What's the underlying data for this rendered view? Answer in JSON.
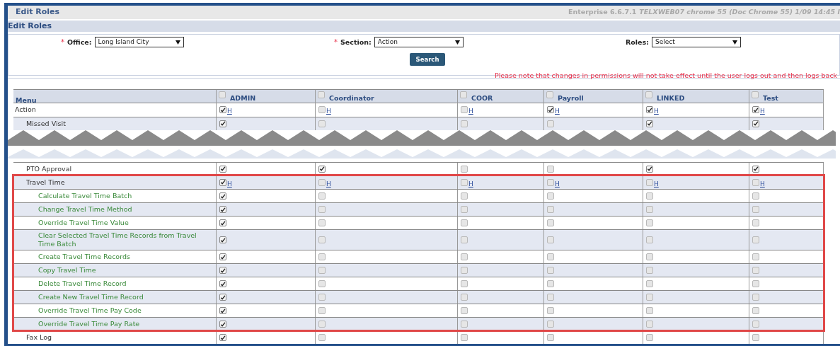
{
  "header": {
    "title": "Edit Roles",
    "version": "Enterprise 6.6.7.1",
    "build_info": "TELXWEB07 chrome 55 (Doc Chrome 55) 1/09 14:45 I"
  },
  "section_title": "Edit Roles",
  "filters": [
    {
      "required_mark": "*",
      "label": "Office:",
      "value": "Long Island City"
    },
    {
      "required_mark": "*",
      "label": "Section:",
      "value": "Action"
    },
    {
      "label": "Roles:",
      "value": "Select"
    }
  ],
  "search_button": "Search",
  "notice": "Please note that changes in permissions will not take effect until the user logs out and then logs back",
  "table": {
    "menu_heading": "Menu",
    "columns": [
      {
        "label": "ADMIN",
        "checked": false
      },
      {
        "label": "Coordinator",
        "checked": false
      },
      {
        "label": "COOR",
        "checked": false
      },
      {
        "label": "Payroll",
        "checked": false
      },
      {
        "label": "LINKED",
        "checked": false
      },
      {
        "label": "Test",
        "checked": false
      }
    ],
    "rows": [
      {
        "kind": "item",
        "name": "Action",
        "highlighted": false,
        "roles": [
          {
            "checked": true,
            "link": "H"
          },
          {
            "checked": false,
            "link": "H"
          },
          {
            "checked": false,
            "link": "H"
          },
          {
            "checked": true,
            "link": "H"
          },
          {
            "checked": true,
            "link": "H"
          },
          {
            "checked": true,
            "link": "H"
          }
        ],
        "children": [
          {
            "kind": "item",
            "name": "Missed Visit",
            "highlighted": false,
            "roles": [
              {
                "checked": true
              },
              {
                "checked": false
              },
              {
                "checked": false
              },
              {
                "checked": false
              },
              {
                "checked": true
              },
              {
                "checked": true
              }
            ]
          },
          {
            "kind": "break"
          },
          {
            "kind": "item",
            "name": "PTO Approval",
            "highlighted": false,
            "roles": [
              {
                "checked": true
              },
              {
                "checked": true
              },
              {
                "checked": false
              },
              {
                "checked": false
              },
              {
                "checked": true
              },
              {
                "checked": true
              }
            ]
          },
          {
            "kind": "item",
            "name": "Travel Time",
            "highlighted": true,
            "roles": [
              {
                "checked": true,
                "link": "H"
              },
              {
                "checked": false,
                "link": "H"
              },
              {
                "checked": false,
                "link": "H"
              },
              {
                "checked": false,
                "link": "H"
              },
              {
                "checked": false,
                "link": "H"
              },
              {
                "checked": false,
                "link": "H"
              }
            ],
            "children": [
              {
                "kind": "item",
                "name": "Calculate Travel Time Batch",
                "highlighted": false,
                "roles": [
                  {
                    "checked": true
                  },
                  {
                    "checked": false
                  },
                  {
                    "checked": false
                  },
                  {
                    "checked": false
                  },
                  {
                    "checked": false
                  },
                  {
                    "checked": false
                  }
                ]
              },
              {
                "kind": "item",
                "name": "Change Travel Time Method",
                "highlighted": false,
                "roles": [
                  {
                    "checked": true
                  },
                  {
                    "checked": false
                  },
                  {
                    "checked": false
                  },
                  {
                    "checked": false
                  },
                  {
                    "checked": false
                  },
                  {
                    "checked": false
                  }
                ]
              },
              {
                "kind": "item",
                "name": "Override Travel Time Value",
                "highlighted": false,
                "roles": [
                  {
                    "checked": true
                  },
                  {
                    "checked": false
                  },
                  {
                    "checked": false
                  },
                  {
                    "checked": false
                  },
                  {
                    "checked": false
                  },
                  {
                    "checked": false
                  }
                ]
              },
              {
                "kind": "item",
                "name": "Clear Selected Travel Time Records from Travel Time Batch",
                "highlighted": false,
                "roles": [
                  {
                    "checked": true
                  },
                  {
                    "checked": false
                  },
                  {
                    "checked": false
                  },
                  {
                    "checked": false
                  },
                  {
                    "checked": false
                  },
                  {
                    "checked": false
                  }
                ]
              },
              {
                "kind": "item",
                "name": "Create Travel Time Records",
                "highlighted": false,
                "roles": [
                  {
                    "checked": true
                  },
                  {
                    "checked": false
                  },
                  {
                    "checked": false
                  },
                  {
                    "checked": false
                  },
                  {
                    "checked": false
                  },
                  {
                    "checked": false
                  }
                ]
              },
              {
                "kind": "item",
                "name": "Copy Travel Time",
                "highlighted": false,
                "roles": [
                  {
                    "checked": true
                  },
                  {
                    "checked": false
                  },
                  {
                    "checked": false
                  },
                  {
                    "checked": false
                  },
                  {
                    "checked": false
                  },
                  {
                    "checked": false
                  }
                ]
              },
              {
                "kind": "item",
                "name": "Delete Travel Time Record",
                "highlighted": false,
                "roles": [
                  {
                    "checked": true
                  },
                  {
                    "checked": false
                  },
                  {
                    "checked": false
                  },
                  {
                    "checked": false
                  },
                  {
                    "checked": false
                  },
                  {
                    "checked": false
                  }
                ]
              },
              {
                "kind": "item",
                "name": "Create New Travel Time Record",
                "highlighted": false,
                "roles": [
                  {
                    "checked": true
                  },
                  {
                    "checked": false
                  },
                  {
                    "checked": false
                  },
                  {
                    "checked": false
                  },
                  {
                    "checked": false
                  },
                  {
                    "checked": false
                  }
                ]
              },
              {
                "kind": "item",
                "name": "Override Travel Time Pay Code",
                "highlighted": false,
                "roles": [
                  {
                    "checked": true
                  },
                  {
                    "checked": false
                  },
                  {
                    "checked": false
                  },
                  {
                    "checked": false
                  },
                  {
                    "checked": false
                  },
                  {
                    "checked": false
                  }
                ]
              },
              {
                "kind": "item",
                "name": "Override Travel Time Pay Rate",
                "highlighted": false,
                "roles": [
                  {
                    "checked": true
                  },
                  {
                    "checked": false
                  },
                  {
                    "checked": false
                  },
                  {
                    "checked": false
                  },
                  {
                    "checked": false
                  },
                  {
                    "checked": false
                  }
                ]
              }
            ]
          },
          {
            "kind": "item",
            "name": "Fax Log",
            "highlighted": false,
            "roles": [
              {
                "checked": true
              },
              {
                "checked": false
              },
              {
                "checked": false
              },
              {
                "checked": false
              },
              {
                "checked": false
              },
              {
                "checked": false
              }
            ]
          }
        ]
      }
    ]
  }
}
